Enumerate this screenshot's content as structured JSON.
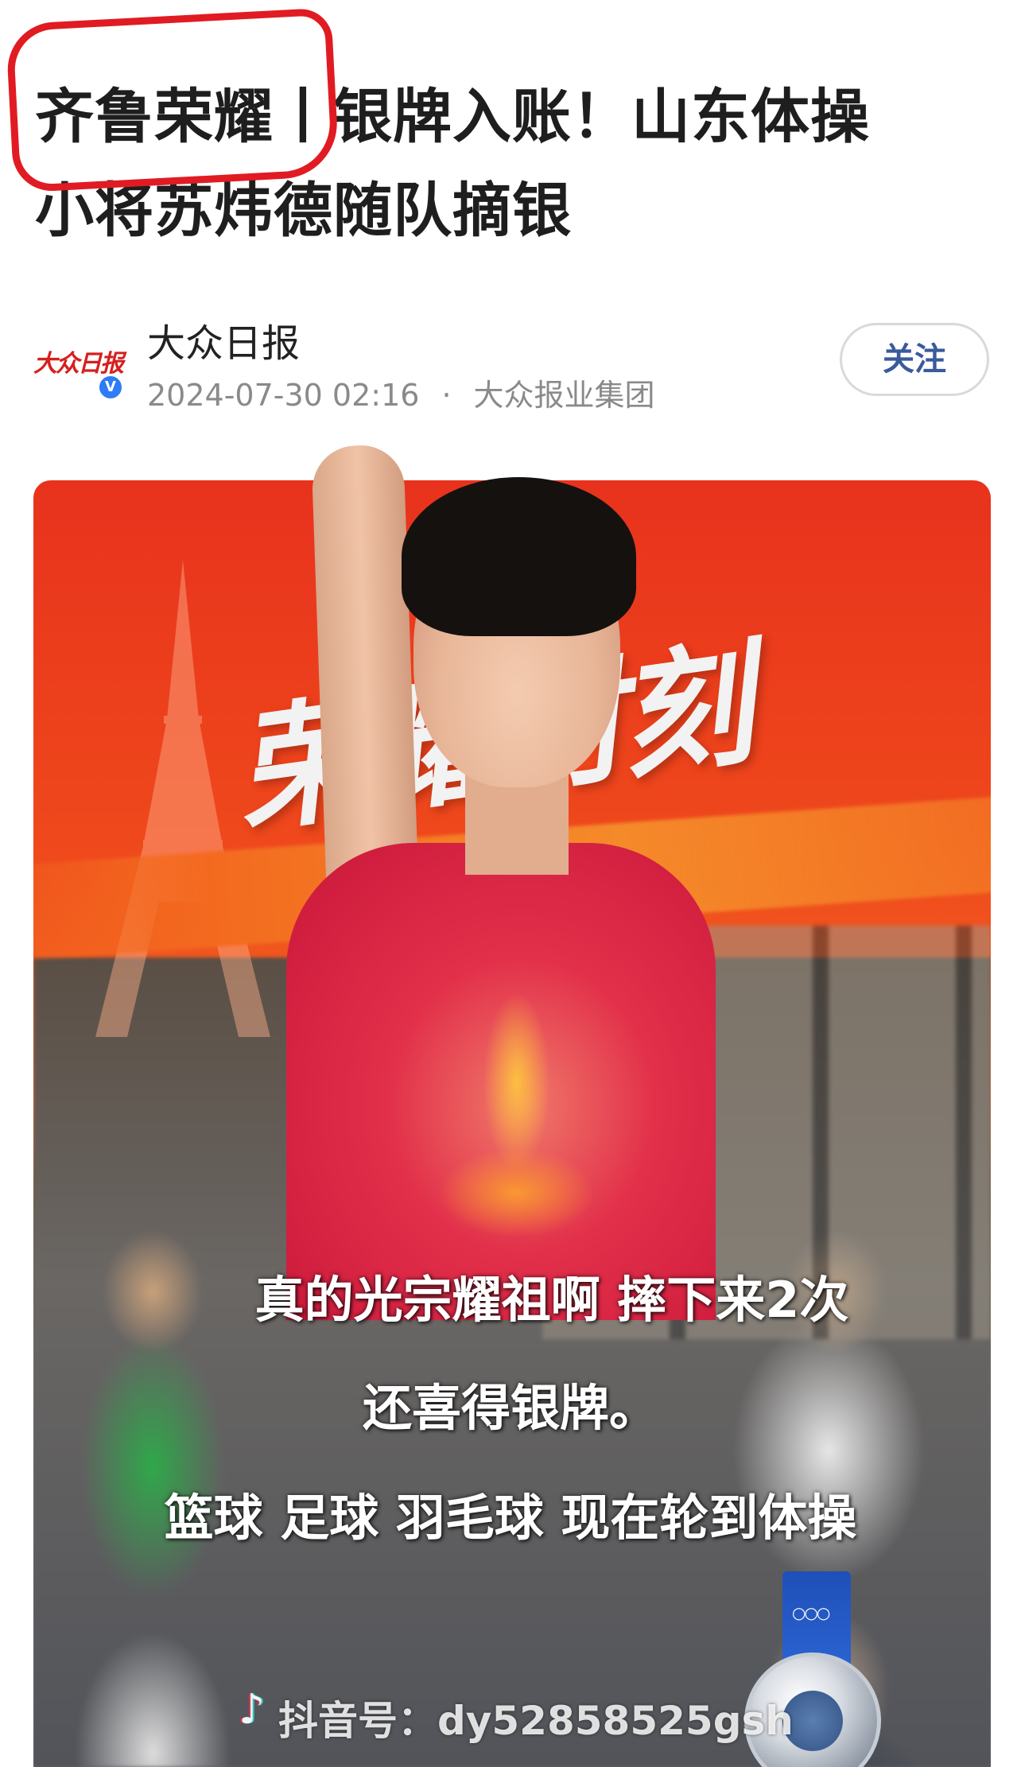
{
  "article": {
    "headline_line1": "齐鲁荣耀丨银牌入账！山东体操",
    "headline_line2": "小将苏炜德随队摘银"
  },
  "author": {
    "name": "大众日报",
    "logo_text": "大众日报",
    "verified_mark": "V",
    "date": "2024-07-30 02:16",
    "separator": "·",
    "organization": "大众报业集团",
    "follow_label": "关注"
  },
  "poster": {
    "title": "荣耀时刻",
    "caption_line1": "真的光宗耀祖啊 摔下来2次",
    "caption_line2": "还喜得银牌。",
    "caption_line3": "篮球  足球 羽毛球 现在轮到体操"
  },
  "watermark": {
    "logo": "♪",
    "text": "抖音号：dy52858525gsh"
  },
  "colors": {
    "annotation_circle": "#e11b22",
    "poster_red": "#e8321d",
    "follow_text": "#3a5a9b",
    "verified_badge": "#2e7cf6"
  }
}
